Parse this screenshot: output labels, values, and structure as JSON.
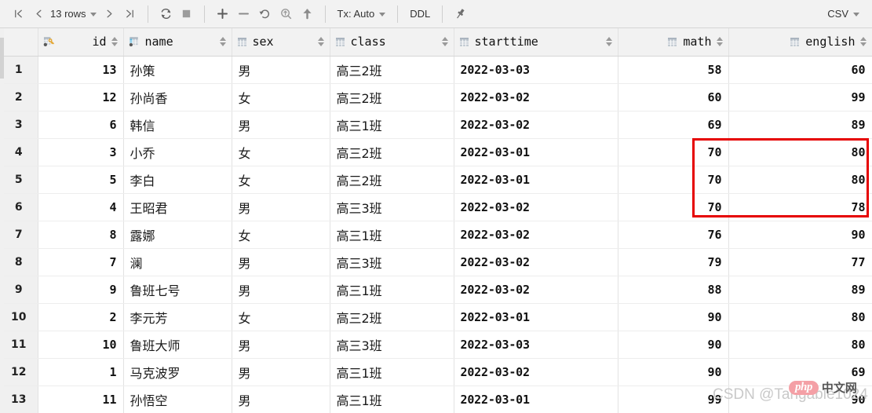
{
  "toolbar": {
    "first_page_icon": "first-page-icon",
    "prev_page_icon": "prev-page-icon",
    "rows_label": "13 rows",
    "next_page_icon": "next-page-icon",
    "last_page_icon": "last-page-icon",
    "refresh_icon": "refresh-icon",
    "stop_icon": "stop-icon",
    "add_row_label": "+",
    "remove_row_label": "−",
    "revert_icon": "revert-icon",
    "find_icon": "find-replace-icon",
    "submit_icon": "submit-icon",
    "tx_label": "Tx: Auto",
    "ddl_label": "DDL",
    "pin_icon": "pin-icon",
    "csv_label": "CSV"
  },
  "grid": {
    "row_header_label": "",
    "columns": [
      {
        "key": "id",
        "label": "id",
        "icon": "primary-key-column-icon",
        "align": "right"
      },
      {
        "key": "name",
        "label": "name",
        "icon": "indexed-column-icon",
        "align": "left"
      },
      {
        "key": "sex",
        "label": "sex",
        "icon": "column-icon",
        "align": "left"
      },
      {
        "key": "class",
        "label": "class",
        "icon": "column-icon",
        "align": "left"
      },
      {
        "key": "starttime",
        "label": "starttime",
        "icon": "column-icon",
        "align": "left"
      },
      {
        "key": "math",
        "label": "math",
        "icon": "column-icon",
        "align": "right"
      },
      {
        "key": "english",
        "label": "english",
        "icon": "column-icon",
        "align": "right"
      }
    ],
    "rows": [
      {
        "n": "1",
        "id": "13",
        "name": "孙策",
        "sex": "男",
        "class": "高三2班",
        "starttime": "2022-03-03",
        "math": "58",
        "english": "60"
      },
      {
        "n": "2",
        "id": "12",
        "name": "孙尚香",
        "sex": "女",
        "class": "高三2班",
        "starttime": "2022-03-02",
        "math": "60",
        "english": "99"
      },
      {
        "n": "3",
        "id": "6",
        "name": "韩信",
        "sex": "男",
        "class": "高三1班",
        "starttime": "2022-03-02",
        "math": "69",
        "english": "89"
      },
      {
        "n": "4",
        "id": "3",
        "name": "小乔",
        "sex": "女",
        "class": "高三2班",
        "starttime": "2022-03-01",
        "math": "70",
        "english": "80"
      },
      {
        "n": "5",
        "id": "5",
        "name": "李白",
        "sex": "女",
        "class": "高三2班",
        "starttime": "2022-03-01",
        "math": "70",
        "english": "80"
      },
      {
        "n": "6",
        "id": "4",
        "name": "王昭君",
        "sex": "男",
        "class": "高三3班",
        "starttime": "2022-03-02",
        "math": "70",
        "english": "78"
      },
      {
        "n": "7",
        "id": "8",
        "name": "露娜",
        "sex": "女",
        "class": "高三1班",
        "starttime": "2022-03-02",
        "math": "76",
        "english": "90"
      },
      {
        "n": "8",
        "id": "7",
        "name": "澜",
        "sex": "男",
        "class": "高三3班",
        "starttime": "2022-03-02",
        "math": "79",
        "english": "77"
      },
      {
        "n": "9",
        "id": "9",
        "name": "鲁班七号",
        "sex": "男",
        "class": "高三1班",
        "starttime": "2022-03-02",
        "math": "88",
        "english": "89"
      },
      {
        "n": "10",
        "id": "2",
        "name": "李元芳",
        "sex": "女",
        "class": "高三2班",
        "starttime": "2022-03-01",
        "math": "90",
        "english": "80"
      },
      {
        "n": "11",
        "id": "10",
        "name": "鲁班大师",
        "sex": "男",
        "class": "高三3班",
        "starttime": "2022-03-03",
        "math": "90",
        "english": "80"
      },
      {
        "n": "12",
        "id": "1",
        "name": "马克波罗",
        "sex": "男",
        "class": "高三1班",
        "starttime": "2022-03-02",
        "math": "90",
        "english": "69"
      },
      {
        "n": "13",
        "id": "11",
        "name": "孙悟空",
        "sex": "男",
        "class": "高三1班",
        "starttime": "2022-03-01",
        "math": "99",
        "english": "90"
      }
    ]
  },
  "annotation": {
    "highlight_color": "#e60000",
    "covers_rows": "4-6",
    "covers_columns": "math, english"
  },
  "watermarks": {
    "csdn": "CSDN @Tangable1024",
    "php_pill": "php",
    "php_cn": "中文网"
  }
}
